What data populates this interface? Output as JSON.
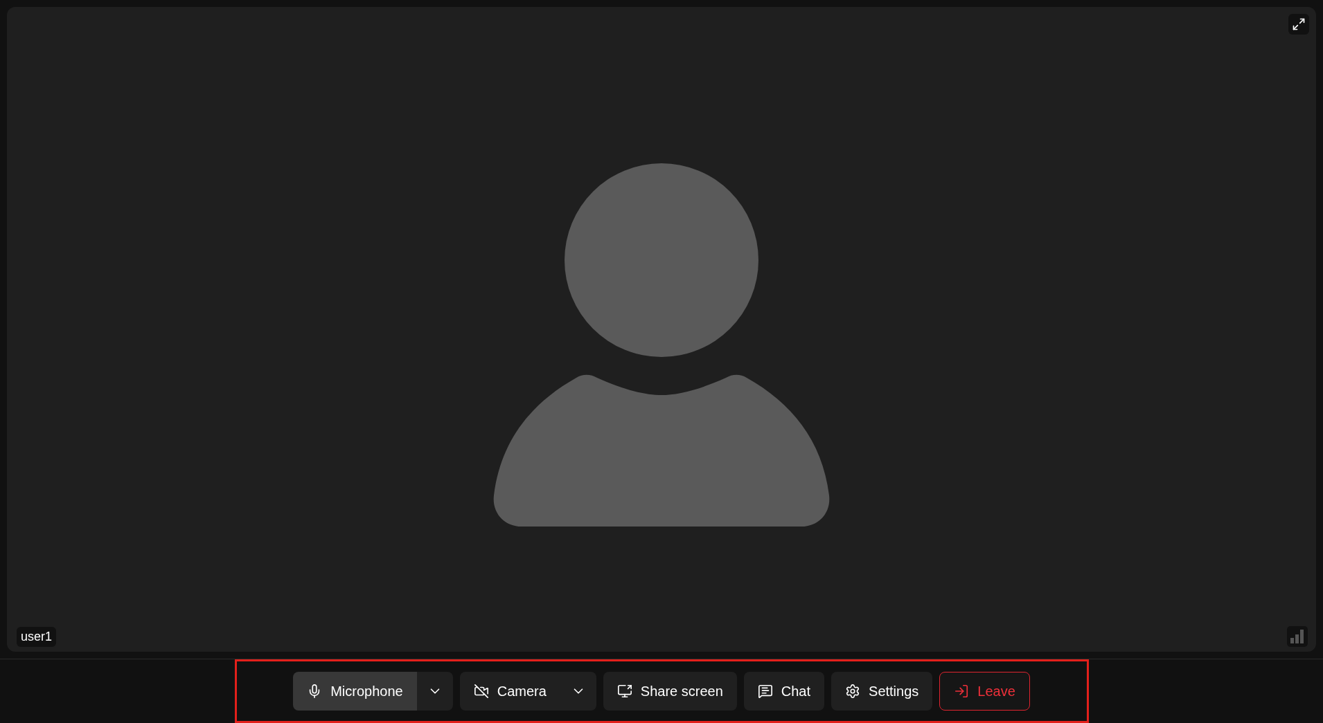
{
  "participant": {
    "name": "user1",
    "camera_on": false
  },
  "controls": [
    {
      "kind": "microphone",
      "label": "Microphone",
      "on": true,
      "has_menu": true
    },
    {
      "kind": "camera",
      "label": "Camera",
      "on": false,
      "has_menu": true
    },
    {
      "kind": "share",
      "label": "Share screen",
      "on": false,
      "has_menu": false
    },
    {
      "kind": "chat",
      "label": "Chat",
      "on": false,
      "has_menu": false
    },
    {
      "kind": "settings",
      "label": "Settings",
      "on": false,
      "has_menu": false
    },
    {
      "kind": "leave",
      "label": "Leave",
      "on": false,
      "has_menu": false
    }
  ]
}
